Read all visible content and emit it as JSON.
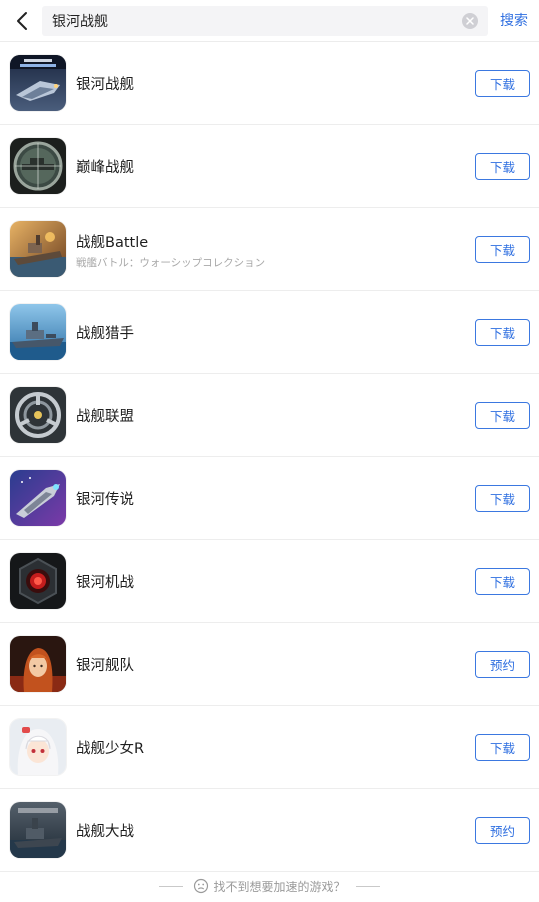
{
  "header": {
    "search_value": "银河战舰",
    "search_button": "搜索"
  },
  "apps": [
    {
      "name": "银河战舰",
      "subtitle": "",
      "action": "下载",
      "icon": "galaxy-battleship-app-icon"
    },
    {
      "name": "巅峰战舰",
      "subtitle": "",
      "action": "下载",
      "icon": "peak-battleship-app-icon"
    },
    {
      "name": "战舰Battle",
      "subtitle": "戦艦バトル：ウォーシップコレクション",
      "action": "下载",
      "icon": "battleship-battle-app-icon"
    },
    {
      "name": "战舰猎手",
      "subtitle": "",
      "action": "下载",
      "icon": "battleship-hunter-app-icon"
    },
    {
      "name": "战舰联盟",
      "subtitle": "",
      "action": "下载",
      "icon": "battleship-alliance-app-icon"
    },
    {
      "name": "银河传说",
      "subtitle": "",
      "action": "下载",
      "icon": "galaxy-legend-app-icon"
    },
    {
      "name": "银河机战",
      "subtitle": "",
      "action": "下载",
      "icon": "galaxy-mech-app-icon"
    },
    {
      "name": "银河舰队",
      "subtitle": "",
      "action": "预约",
      "icon": "galaxy-fleet-app-icon"
    },
    {
      "name": "战舰少女R",
      "subtitle": "",
      "action": "下载",
      "icon": "warship-girls-app-icon"
    },
    {
      "name": "战舰大战",
      "subtitle": "",
      "action": "预约",
      "icon": "battleship-war-app-icon"
    }
  ],
  "footer": {
    "text": "找不到想要加速的游戏？"
  },
  "colors": {
    "accent": "#2f6fe0",
    "divider": "#ededed",
    "search_bg": "#f4f4f6"
  }
}
